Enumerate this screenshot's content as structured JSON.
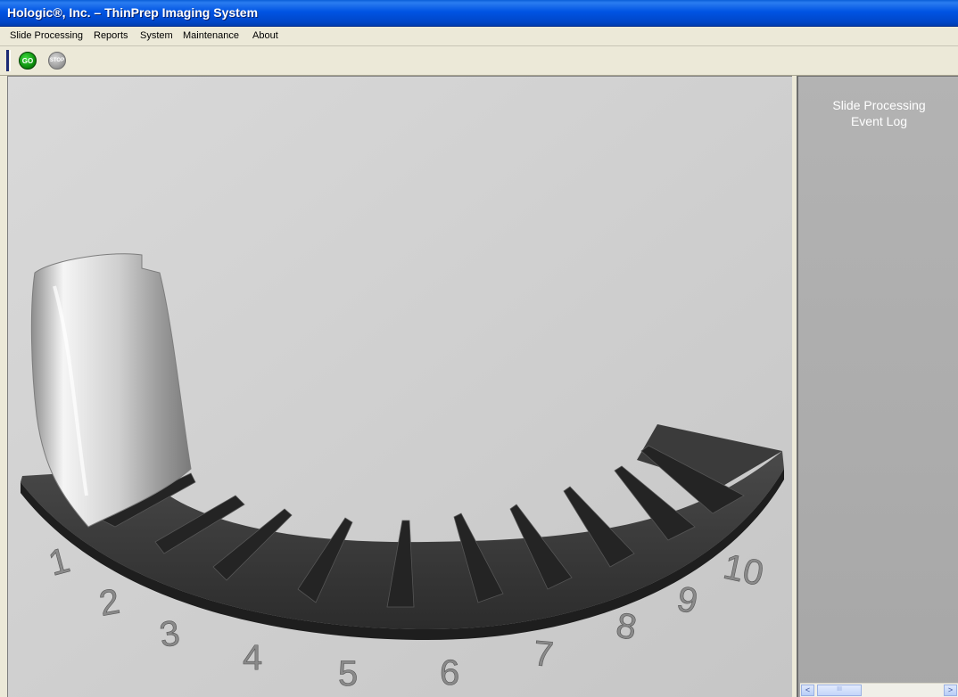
{
  "window": {
    "title": "Hologic®, Inc. – ThinPrep Imaging System"
  },
  "menu": {
    "items": [
      "Slide Processing",
      "Reports",
      "System",
      "Maintenance",
      "About"
    ]
  },
  "toolbar": {
    "go_label": "GO",
    "stop_label": "STOP"
  },
  "carousel": {
    "slot_numbers": [
      "1",
      "2",
      "3",
      "4",
      "5",
      "6",
      "7",
      "8",
      "9",
      "10"
    ]
  },
  "event_log": {
    "title": "Slide Processing\nEvent Log"
  },
  "scrollbar": {
    "left_arrow": "<",
    "right_arrow": ">",
    "thumb_grip": "III"
  },
  "colors": {
    "titlebar": "#0054e3",
    "canvas": "#cfcfcf",
    "panel": "#ababab",
    "tray": "#3a3a3a"
  }
}
